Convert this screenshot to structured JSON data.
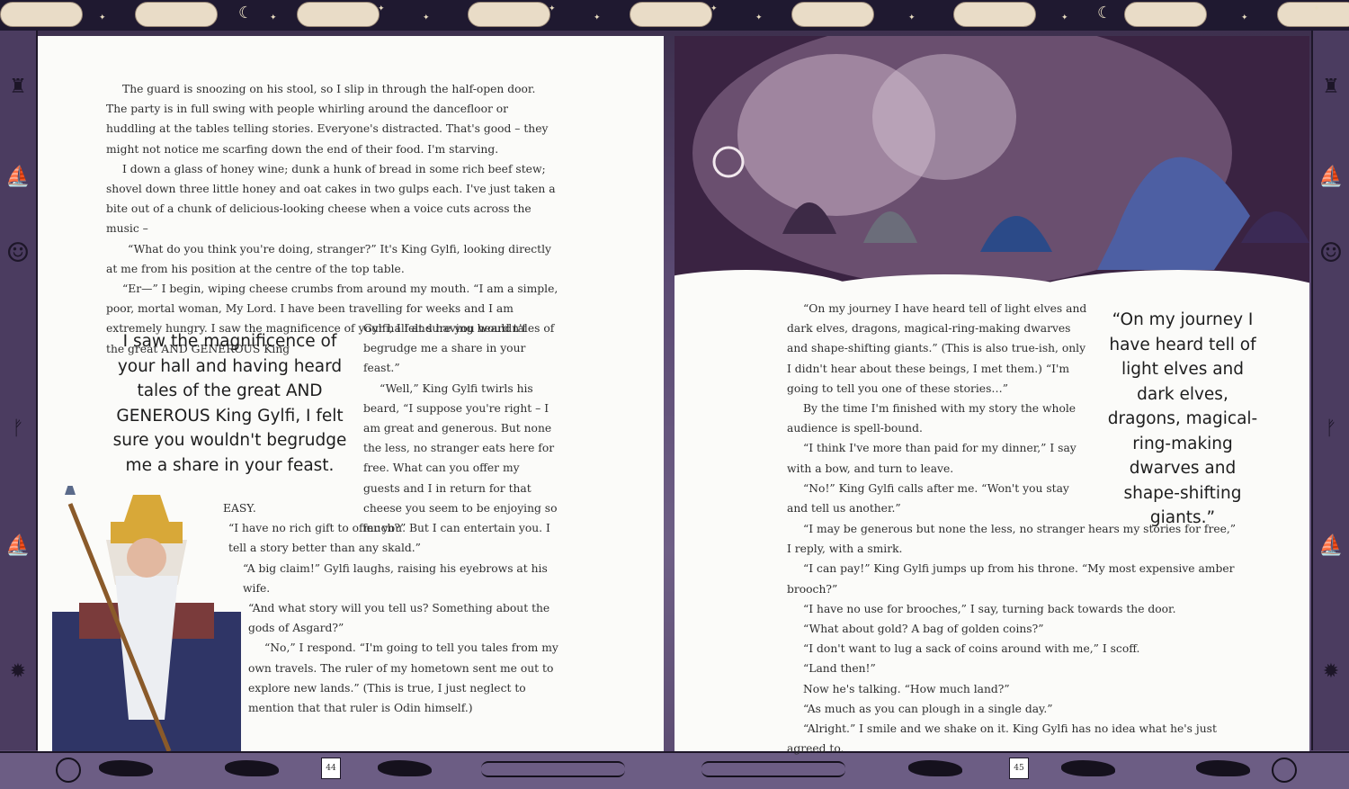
{
  "left_page": {
    "paragraphs_top": [
      "The guard is snoozing on his stool, so I slip in through the half-open door. The party is in full swing with people whirling around the dancefloor or huddling at the tables telling stories. Everyone's distracted. That's good – they might not notice me scarfing down the end of their food. I'm starving.",
      "I down a glass of honey wine; dunk a hunk of bread in some rich beef stew; shovel down three little honey and oat cakes in two gulps each. I've just taken a bite out of a chunk of delicious-looking cheese when a voice cuts across the music –",
      "“What do you think you're doing, stranger?” It's King Gylfi, looking directly at me from his position at the centre of the top table.",
      "“Er—” I begin, wiping cheese crumbs from around my mouth. “I am a simple, poor, mortal woman, My Lord. I have been travelling for weeks and I am extremely hungry. I saw the magnificence of your hall and having heard tales of the great AND GENEROUS King"
    ],
    "paragraphs_column": [
      "Gylfi, I felt sure you wouldn't begrudge me a share in your feast.”",
      "“Well,” King Gylfi twirls his beard, “I suppose you're right – I am great and generous. But none the less, no stranger eats here for free. What can you offer my guests and I in return for that cheese you seem to be enjoying so much?”"
    ],
    "line_easy": "EASY.",
    "paragraphs_bottom": [
      "“I have no rich gift to offer you. But I can entertain you. I tell a story better than any skald.”",
      "“A big claim!” Gylfi laughs, raising his eyebrows at his wife.",
      "“And what story will you tell us? Something about the gods of Asgard?”",
      "“No,” I respond. “I'm going to tell you tales from my own travels. The ruler of my hometown sent me out to explore new lands.” (This is true, I just neglect to mention that that ruler is Odin himself.)"
    ],
    "pull_quote": "I saw the magnificence of your hall and having heard tales of the great AND GENEROUS King Gylfi, I felt sure you wouldn't begrudge me a share in your feast.",
    "page_number": "44"
  },
  "right_page": {
    "paragraphs_column": [
      "“On my journey I have heard tell of light elves and dark elves, dragons, magical-ring-making dwarves and shape-shifting giants.” (This is also true-ish, only I didn't hear about these beings, I met them.) “I'm going to tell you one of these stories…”",
      "By the time I'm finished with my story the whole audience is spell-bound.",
      "“I think I've more than paid for my dinner,” I say with a bow, and turn to leave.",
      "“No!” King Gylfi calls after me. “Won't you stay and tell us another.”"
    ],
    "paragraphs_full": [
      "“I may be generous but none the less, no stranger hears my stories for free,” I reply, with a smirk.",
      "“I can pay!” King Gylfi jumps up from his throne. “My most expensive amber brooch?”",
      "“I have no use for brooches,” I say, turning back towards the door.",
      "“What about gold? A bag of golden coins?”",
      "“I don't want to lug a sack of coins around with me,” I scoff.",
      "“Land then!”",
      "Now he's talking. “How much land?”",
      "“As much as you can plough in a single day.”",
      "“Alright.” I smile and we shake on it. King Gylfi has no idea what he's just agreed to."
    ],
    "pull_quote": "“On my journey I have heard tell of light elves and dark elves, dragons, magical-ring-making dwarves and shape-shifting giants.”",
    "page_number": "45"
  },
  "colors": {
    "border_dark": "#1f1930",
    "border_purple": "#5b4a73",
    "page_bg": "#fbfbf9",
    "cloud": "#e9dcc7"
  }
}
